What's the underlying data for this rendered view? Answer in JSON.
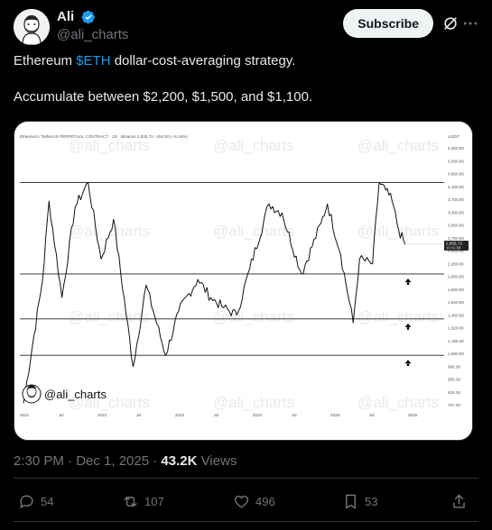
{
  "author": {
    "name": "Ali",
    "handle": "@ali_charts",
    "subscribe_label": "Subscribe"
  },
  "tweet": {
    "line1_prefix": "Ethereum ",
    "cashtag": "$ETH",
    "line1_suffix": " dollar-cost-averaging strategy.",
    "line2": "Accumulate between $2,200, $1,500, and $1,100."
  },
  "chart": {
    "header_text": "Ethereum / TetherUS PERPETUAL CONTRACT · 1D · Binance  2,835.72  −154.00 (−5.16%)",
    "currency": "USDT",
    "watermark": "@ali_charts",
    "badge_text": "@ali_charts",
    "current_price": "2,835.72",
    "current_time": "10:41:58",
    "y_ticks": [
      "6,250.00",
      "5,000.00",
      "4,600.00",
      "4,100.00",
      "3,700.00",
      "3,300.00",
      "3,000.00",
      "2,700.00",
      "2,400.00",
      "2,200.00",
      "2,000.00",
      "1,800.00",
      "1,640.00",
      "1,480.00",
      "1,320.00",
      "1,195.00",
      "1,080.00",
      "986.00",
      "905.00",
      "825.00",
      "757.00"
    ],
    "x_ticks": [
      "2021",
      "Jul",
      "2022",
      "Jul",
      "2023",
      "Jul",
      "2024",
      "Jul",
      "2025",
      "Jul",
      "2026"
    ],
    "accumulation_levels": [
      2200,
      1500,
      1100
    ],
    "resistance_level": 4800,
    "chart_data": {
      "type": "line",
      "series": [
        {
          "x": [
            "2021-01",
            "2021-04",
            "2021-05",
            "2021-07",
            "2021-09",
            "2021-11",
            "2022-01",
            "2022-03",
            "2022-06",
            "2022-08",
            "2022-11",
            "2023-01",
            "2023-04",
            "2023-06",
            "2023-08",
            "2023-10",
            "2023-12",
            "2024-03",
            "2024-05",
            "2024-08",
            "2024-11",
            "2024-12",
            "2025-02",
            "2025-04",
            "2025-05",
            "2025-07",
            "2025-08",
            "2025-09",
            "2025-10",
            "2025-11",
            "2025-12"
          ],
          "y": [
            730,
            2100,
            4100,
            1800,
            3900,
            4800,
            2500,
            3500,
            1000,
            2000,
            1100,
            1600,
            2100,
            1800,
            1650,
            1550,
            2300,
            4000,
            3700,
            2200,
            3400,
            4000,
            2600,
            1450,
            2500,
            2400,
            4800,
            4500,
            4100,
            3200,
            2835
          ]
        }
      ]
    }
  },
  "meta": {
    "time": "2:30 PM · Dec 1, 2025 · ",
    "views_count": "43.2K",
    "views_label": " Views"
  },
  "actions": {
    "replies": "54",
    "reposts": "107",
    "likes": "496",
    "bookmarks": "53"
  }
}
